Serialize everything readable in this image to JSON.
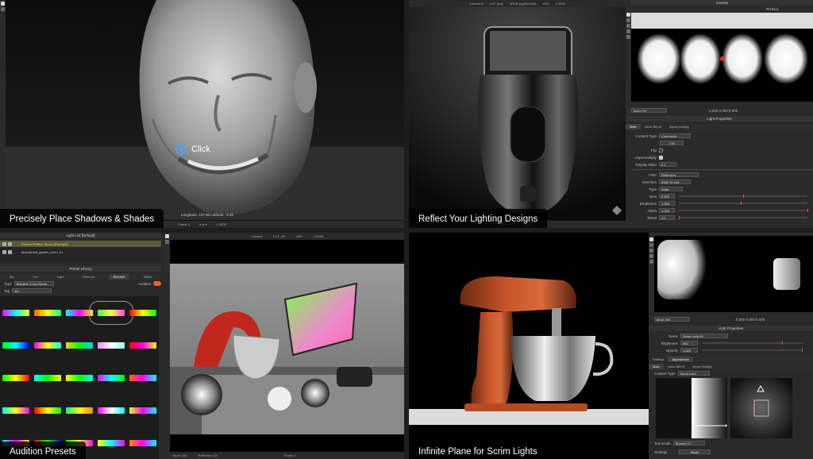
{
  "captions": {
    "tl": "Precisely Place Shadows & Shades",
    "tr": "Reflect Your Lighting Designs",
    "bl": "Audition Presets",
    "br": "Infinite Plane for Scrim Lights"
  },
  "tl": {
    "click_label": "Click",
    "status": "Longitude: 127.96 Latitude: -2.40",
    "frame": "Frame 0",
    "zoom": "1.0000"
  },
  "tr": {
    "top_toolbar": {
      "camera": "Camera 6",
      "lut": "LUT: Auto",
      "color": "sRGB (rgbMonitor)",
      "hsv": "HSV",
      "zoom": "1.0000"
    },
    "canvas_title": "Canvas",
    "rgb_select": "RGB(A)",
    "move_select": "Move (V)",
    "pixel_readout": "0.000 0.000 0.000",
    "light_props_title": "Light Properties",
    "tabs": [
      "Main",
      "Value Blend",
      "Alpha Multiply"
    ],
    "content_type_label": "Content Type",
    "content_type_value": "Composite",
    "content_value": "1.00",
    "flip_label": "Flip",
    "unpremultiply_label": "Unpremultiply",
    "display_ratio_label": "Display Ratio",
    "display_ratio_value": "2:1",
    "filter_label": "Filter",
    "filter_value": "Reflection",
    "direction_label": "Direction",
    "direction_value": "Right To Left",
    "type_label": "Type",
    "type_value": "Wrap",
    "bias_label": "Bias",
    "bias_value": "0.500",
    "brightness_label": "Brightness",
    "brightness_value": "1.000",
    "alpha_label": "Alpha",
    "alpha_value": "1.000",
    "blend_label": "Blend",
    "blend_value": "0.0",
    "frame": "Frame 0",
    "zoom": "1.0000"
  },
  "bl": {
    "light_list_title": "Light List [Default]",
    "light_rows": [
      "Perfect Softbox Studio [EnvLight]",
      "abandoned_games_room_01"
    ],
    "preset_title": "Preset Library",
    "tabs": [
      "Big",
      "Env",
      "Light",
      "Element",
      "Element",
      "Effect"
    ],
    "type_label": "Type",
    "type_value": "Element: Color Ramp",
    "tag_label": "Tag",
    "tag_value": "All",
    "audition_label": "Audition",
    "viewport_toolbar": {
      "camera": "Camera",
      "lut": "LUT: Off",
      "hsv": "HSV",
      "zoom": "1.0000"
    },
    "move_select": "Move (W)",
    "reflection_select": "Reflection (D)",
    "frame": "Frame 0"
  },
  "br": {
    "move_select": "Move (W)",
    "pixel_readout": "0.000 0.000 0.000",
    "light_props_title": "Light Properties",
    "name_label": "Name",
    "name_value": "Scrim Light 09",
    "brightness_label": "Brightness",
    "brightness_value": "800",
    "opacity_label": "Opacity",
    "opacity_value": "1.000",
    "tabs1": [
      "Settings",
      "Appearance"
    ],
    "tabs2": [
      "Main",
      "Value Blend",
      "Alpha Multiply"
    ],
    "content_type_label": "Content Type",
    "content_type_value": "Scrim Light",
    "tool_mode_label": "Tool Mode",
    "tool_mode_value": "Spread (T)",
    "settings_label": "Settings",
    "reset_label": "Reset"
  },
  "colors": {
    "accent": "#e8641e",
    "panel_bg": "#2a2a2a",
    "caption_bg": "#000000"
  }
}
